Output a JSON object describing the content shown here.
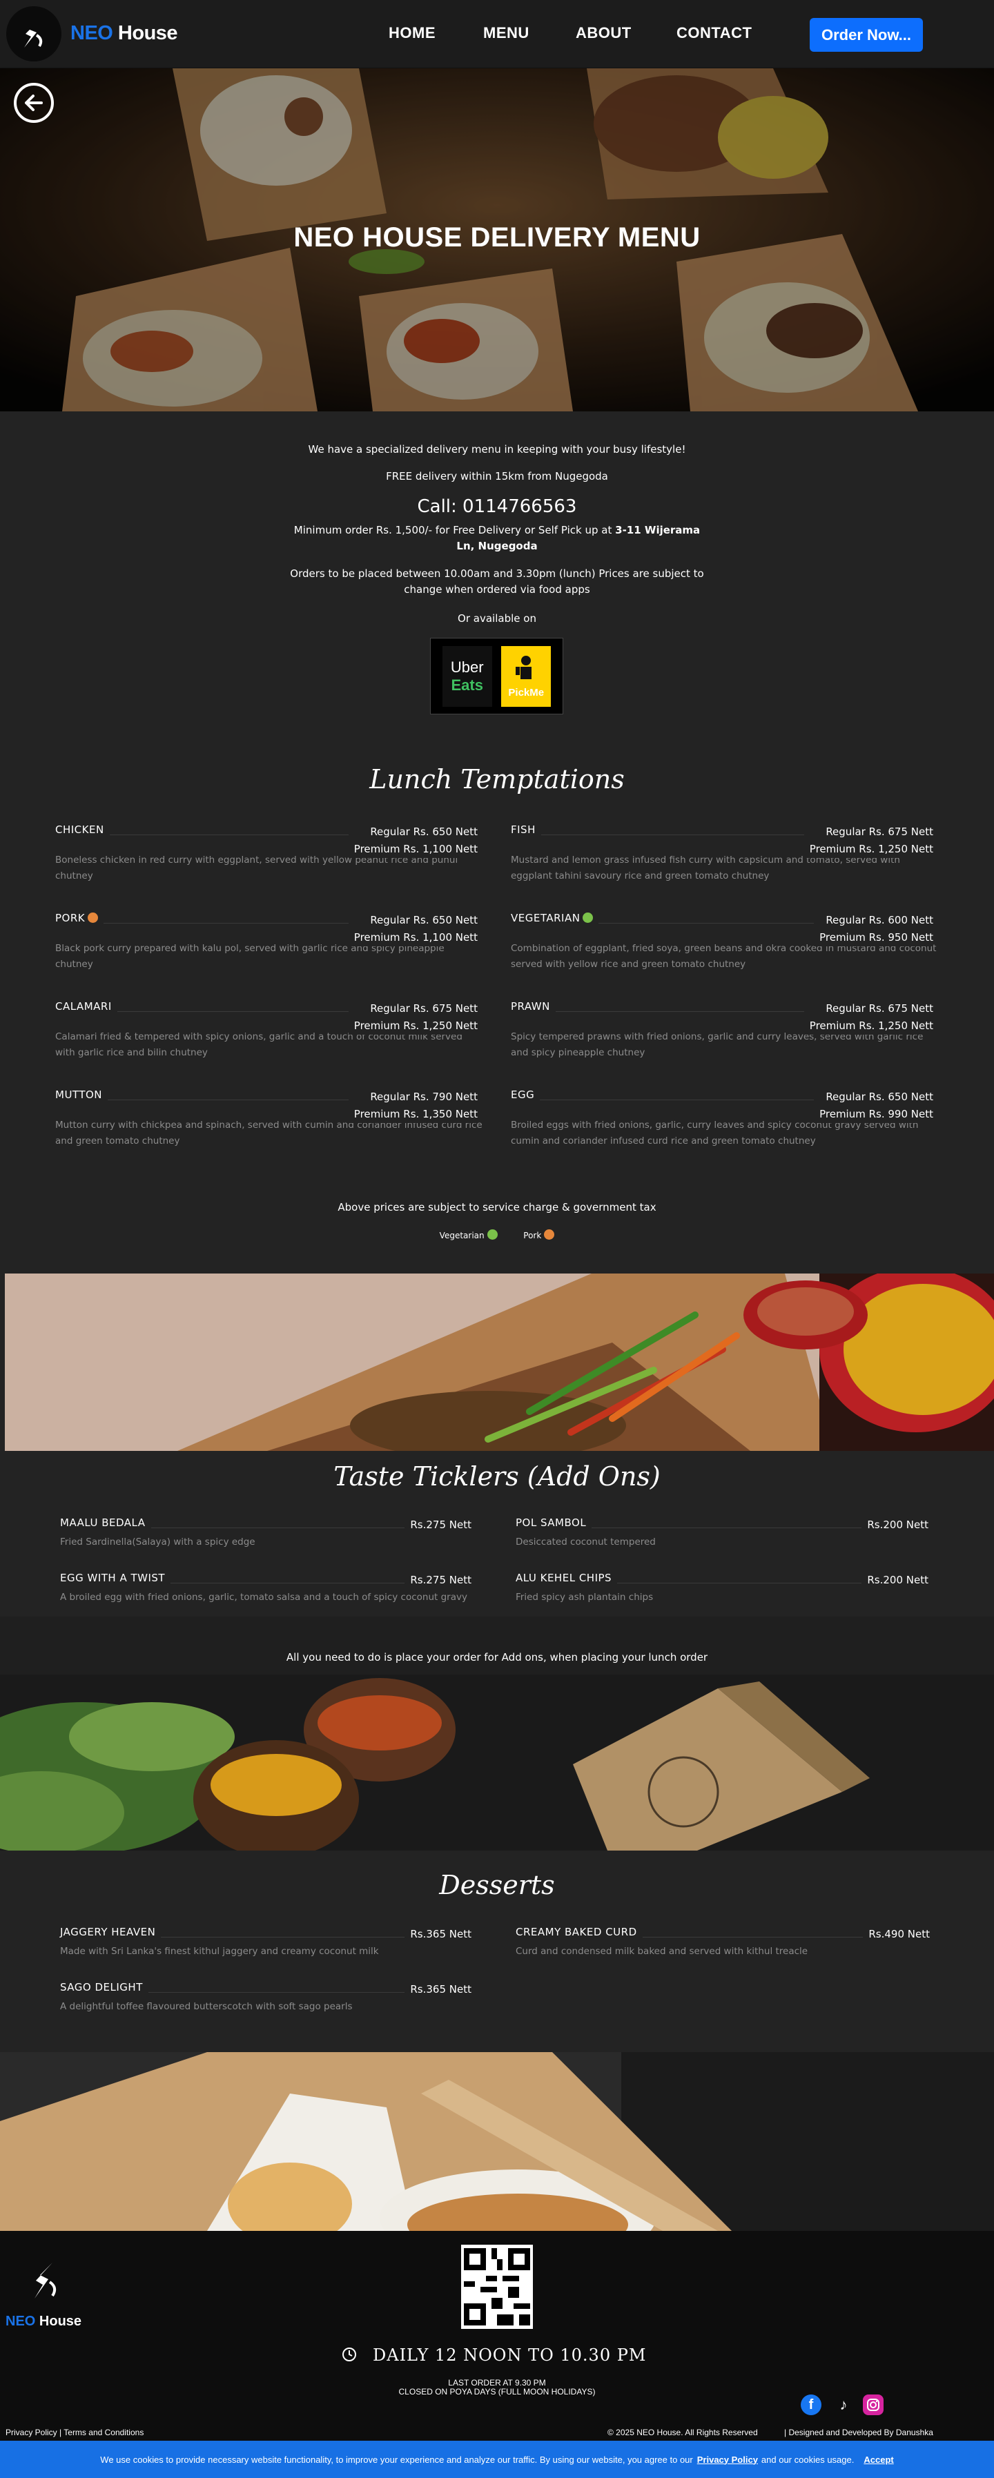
{
  "nav": {
    "brand_neo": "NEO",
    "brand_house": "House",
    "links": [
      "HOME",
      "MENU",
      "ABOUT",
      "CONTACT"
    ],
    "order_button": "Order Now..."
  },
  "hero": {
    "title": "NEO HOUSE DELIVERY MENU"
  },
  "info": {
    "line1": "We have a specialized delivery menu in keeping with your busy lifestyle!",
    "line2": "FREE delivery within 15km from Nugegoda",
    "call": "Call: 0114766563",
    "min_order_prefix": "Minimum order Rs. 1,500/- for Free Delivery or Self Pick up at",
    "min_order_address": "3-11 Wijerama Ln, Nugegoda",
    "orders_time": "Orders to be placed between 10.00am and 3.30pm (lunch) Prices are subject to change when ordered via food apps",
    "available_on": "Or available on",
    "app_uber_line1": "Uber",
    "app_uber_line2": "Eats",
    "app_pickme": "PickMe"
  },
  "lunch": {
    "title": "Lunch Temptations",
    "items": [
      {
        "name": "CHICKEN",
        "tag": "",
        "regular": "Regular Rs. 650 Nett",
        "premium": "Premium Rs. 1,100 Nett",
        "desc": "Boneless chicken in red curry with eggplant, served with yellow peanut rice and puhul chutney"
      },
      {
        "name": "FISH",
        "tag": "",
        "regular": "Regular Rs. 675 Nett",
        "premium": "Premium Rs. 1,250 Nett",
        "desc": "Mustard and lemon grass infused fish curry with capsicum and tomato, served with eggplant tahini savoury rice and green tomato chutney"
      },
      {
        "name": "PORK",
        "tag": "pork",
        "regular": "Regular Rs. 650 Nett",
        "premium": "Premium Rs. 1,100 Nett",
        "desc": "Black pork curry prepared with kalu pol, served with garlic rice and spicy pineapple chutney"
      },
      {
        "name": "VEGETARIAN",
        "tag": "veg",
        "regular": "Regular Rs. 600 Nett",
        "premium": "Premium Rs. 950 Nett",
        "desc": "Combination of eggplant, fried soya, green beans and okra cooked in mustard and coconut served with yellow rice and green tomato chutney"
      },
      {
        "name": "CALAMARI",
        "tag": "",
        "regular": "Regular Rs. 675 Nett",
        "premium": "Premium Rs. 1,250 Nett",
        "desc": "Calamari fried & tempered with spicy onions, garlic and a touch of coconut milk served with garlic rice and bilin chutney"
      },
      {
        "name": "PRAWN",
        "tag": "",
        "regular": "Regular Rs. 675 Nett",
        "premium": "Premium Rs. 1,250 Nett",
        "desc": "Spicy tempered prawns with fried onions, garlic and curry leaves, served with garlic rice and spicy pineapple chutney"
      },
      {
        "name": "MUTTON",
        "tag": "",
        "regular": "Regular Rs. 790 Nett",
        "premium": "Premium Rs. 1,350 Nett",
        "desc": "Mutton curry with chickpea and spinach, served with cumin and coriander infused curd rice and green tomato chutney"
      },
      {
        "name": "EGG",
        "tag": "",
        "regular": "Regular Rs. 650 Nett",
        "premium": "Premium Rs. 990 Nett",
        "desc": "Broiled eggs with fried onions, garlic, curry leaves and spicy coconut gravy served with cumin and coriander infused curd rice and green tomato chutney"
      }
    ],
    "note": "Above prices are subject to service charge & government tax",
    "legend_veg": "Vegetarian",
    "legend_pork": "Pork"
  },
  "addons": {
    "title": "Taste Ticklers (Add Ons)",
    "items": [
      {
        "name": "MAALU BEDALA",
        "price": "Rs.275 Nett",
        "desc": "Fried Sardinella(Salaya) with a spicy edge"
      },
      {
        "name": "POL SAMBOL",
        "price": "Rs.200 Nett",
        "desc": "Desiccated coconut tempered"
      },
      {
        "name": "EGG WITH A TWIST",
        "price": "Rs.275 Nett",
        "desc": "A broiled egg with fried onions, garlic, tomato salsa and a touch of spicy coconut gravy"
      },
      {
        "name": "ALU KEHEL CHIPS",
        "price": "Rs.200 Nett",
        "desc": "Fried spicy ash plantain chips"
      }
    ],
    "note": "All you need to do is place your order for Add ons, when placing your lunch order"
  },
  "desserts": {
    "title": "Desserts",
    "items": [
      {
        "name": "JAGGERY HEAVEN",
        "price": "Rs.365 Nett",
        "desc": "Made with Sri Lanka's finest kithul jaggery and creamy coconut milk"
      },
      {
        "name": "CREAMY BAKED CURD",
        "price": "Rs.490 Nett",
        "desc": "Curd and condensed milk baked and served with kithul treacle"
      },
      {
        "name": "SAGO DELIGHT",
        "price": "Rs.365 Nett",
        "desc": "A delightful toffee flavoured butterscotch with soft sago pearls"
      }
    ]
  },
  "footer": {
    "brand_neo": "NEO",
    "brand_house": "House",
    "hours": "DAILY 12 NOON TO 10.30 PM",
    "last_order": "LAST ORDER AT 9.30 PM",
    "closed": "CLOSED ON POYA DAYS (FULL MOON HOLIDAYS)",
    "privacy": "Privacy Policy",
    "terms": "Terms and Conditions",
    "copyright": "© 2025 NEO House. All Rights Reserved",
    "designed": "Designed and Developed By Danushka"
  },
  "cookie": {
    "text": "We use cookies to provide necessary website functionality, to improve your experience and analyze our traffic. By using our website, you agree to our",
    "policy_link": "Privacy Policy",
    "text2": "and our cookies usage.",
    "accept": "Accept"
  },
  "colors": {
    "accent": "#0d6efd",
    "background": "#232323",
    "pork": "#e6873b",
    "veg": "#7bc24a"
  }
}
